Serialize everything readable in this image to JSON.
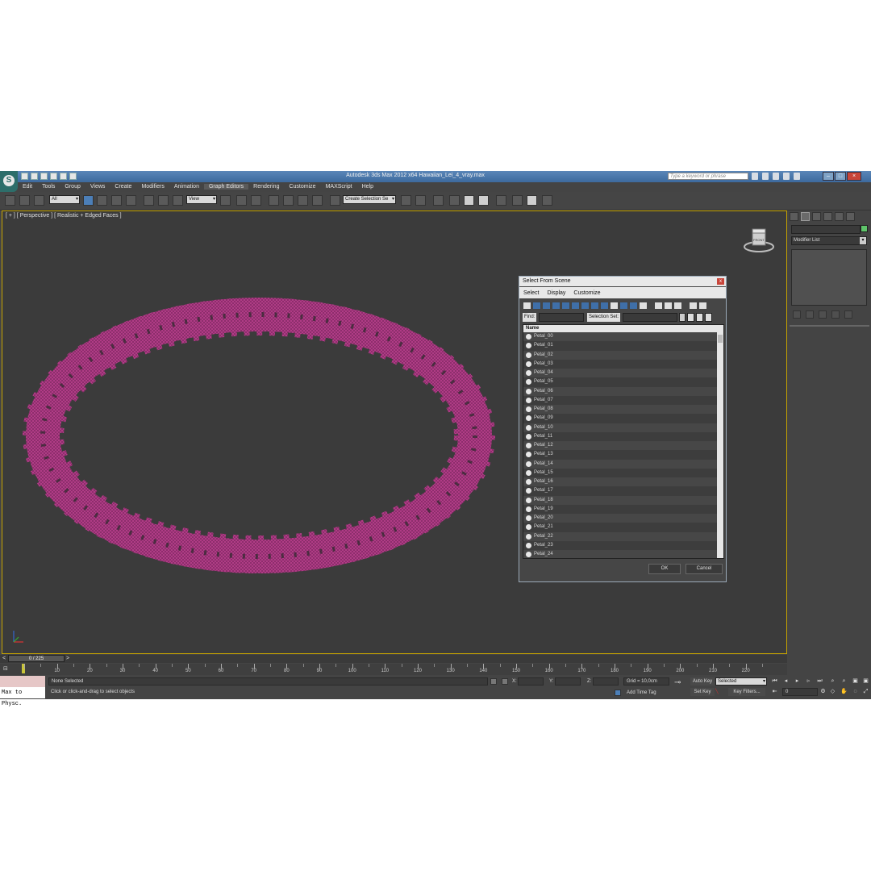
{
  "window": {
    "title": "Autodesk 3ds Max  2012 x64     Hawaiian_Lei_4_vray.max",
    "search_placeholder": "Type a keyword or phrase"
  },
  "menu": [
    "Edit",
    "Tools",
    "Group",
    "Views",
    "Create",
    "Modifiers",
    "Animation",
    "Graph Editors",
    "Rendering",
    "Customize",
    "MAXScript",
    "Help"
  ],
  "toolbar": {
    "filter_value": "All",
    "refcoord_value": "View",
    "selection_set_value": "Create Selection Se"
  },
  "viewport": {
    "label": "[ + ] [ Perspective ] [ Realistic + Edged Faces ]",
    "viewcube_label": "FRONT",
    "accent_color": "#c6a400",
    "object_color": "#b03c86"
  },
  "command_panel": {
    "modifier_list": "Modifier List"
  },
  "dialog": {
    "title": "Select From Scene",
    "menu": [
      "Select",
      "Display",
      "Customize"
    ],
    "find_label": "Find:",
    "selection_set_label": "Selection Set:",
    "column_header": "Name",
    "items": [
      "Petal_00",
      "Petal_01",
      "Petal_02",
      "Petal_03",
      "Petal_04",
      "Petal_05",
      "Petal_06",
      "Petal_07",
      "Petal_08",
      "Petal_09",
      "Petal_10",
      "Petal_11",
      "Petal_12",
      "Petal_13",
      "Petal_14",
      "Petal_15",
      "Petal_16",
      "Petal_17",
      "Petal_18",
      "Petal_19",
      "Petal_20",
      "Petal_21",
      "Petal_22",
      "Petal_23",
      "Petal_24"
    ],
    "ok_label": "OK",
    "cancel_label": "Cancel"
  },
  "timeline": {
    "frame_readout": "0 / 225",
    "ticks": [
      0,
      5,
      10,
      15,
      20,
      25,
      30,
      35,
      40,
      45,
      50,
      55,
      60,
      65,
      70,
      75,
      80,
      85,
      90,
      95,
      100,
      105,
      110,
      115,
      120,
      125,
      130,
      135,
      140,
      145,
      150,
      155,
      160,
      165,
      170,
      175,
      180,
      185,
      190,
      195,
      200,
      205,
      210,
      215,
      220,
      225
    ],
    "labels": [
      "10",
      "20",
      "30",
      "40",
      "50",
      "60",
      "70",
      "80",
      "90",
      "100",
      "110",
      "120",
      "130",
      "140",
      "150",
      "160",
      "170",
      "180",
      "190",
      "200",
      "210",
      "220"
    ]
  },
  "status": {
    "maxscript_text": "Max to Physc.",
    "selection": "None Selected",
    "prompt": "Click or click-and-drag to select objects",
    "x_label": "X:",
    "y_label": "Y:",
    "z_label": "Z:",
    "grid": "Grid = 10,0cm",
    "add_time_tag": "Add Time Tag",
    "auto_key": "Auto Key",
    "set_key": "Set Key",
    "key_mode": "Selected",
    "key_filters": "Key Filters...",
    "current_frame": "0"
  }
}
